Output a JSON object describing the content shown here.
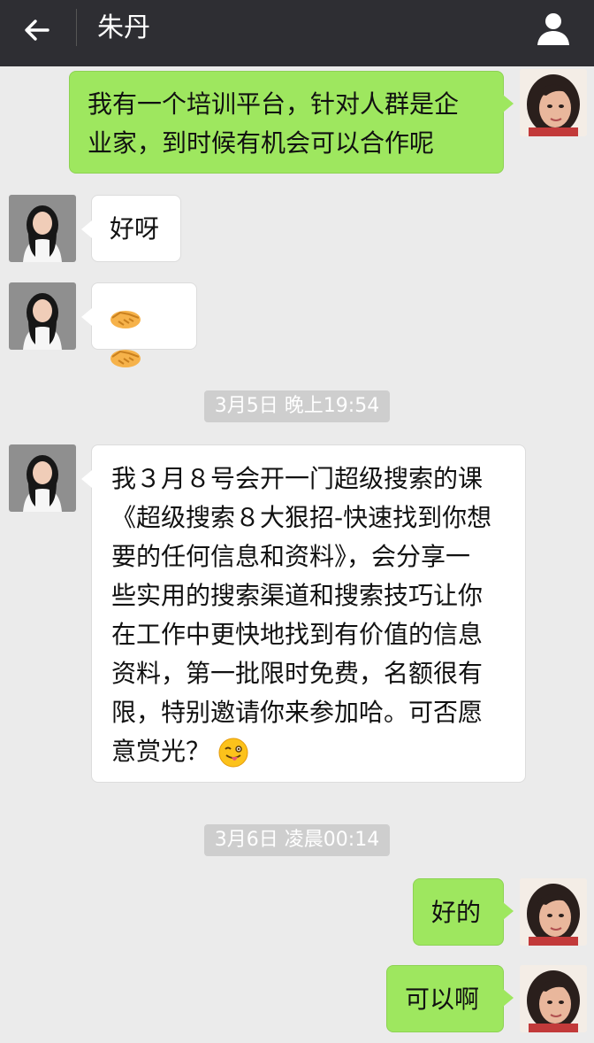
{
  "header": {
    "title": "朱丹",
    "back_icon": "arrow-left-icon",
    "profile_icon": "person-icon"
  },
  "colors": {
    "header_bg": "#2e2e33",
    "outgoing_bubble": "#9ee75f",
    "incoming_bubble": "#ffffff",
    "chat_bg": "#ebebeb",
    "timestamp_bg": "#cecece"
  },
  "messages": [
    {
      "side": "out",
      "lines": [
        "我有一个培训平台，针对人群是企",
        "业家，到时候有机会可以合作呢"
      ]
    },
    {
      "side": "in",
      "text": "好呀"
    },
    {
      "side": "in",
      "emoji": "handshake-icon handshake-icon"
    },
    {
      "timestamp": "3月5日 晚上19:54"
    },
    {
      "side": "in",
      "lines": [
        "我３月８号会开一门超级搜索的课",
        "《超级搜索８大狠招-快速找到你想",
        "要的任何信息和资料》，会分享一",
        "些实用的搜索渠道和搜索技巧让你",
        "在工作中更快地找到有价值的信息",
        "资料，第一批限时免费，名额很有",
        "限，特别邀请你来参加哈。可否愿",
        "意赏光？"
      ],
      "trailing_emoji": "winking-tongue-face-icon"
    },
    {
      "timestamp": "3月6日 凌晨00:14"
    },
    {
      "side": "out",
      "text": "好的"
    },
    {
      "side": "out",
      "text": "可以啊"
    }
  ]
}
